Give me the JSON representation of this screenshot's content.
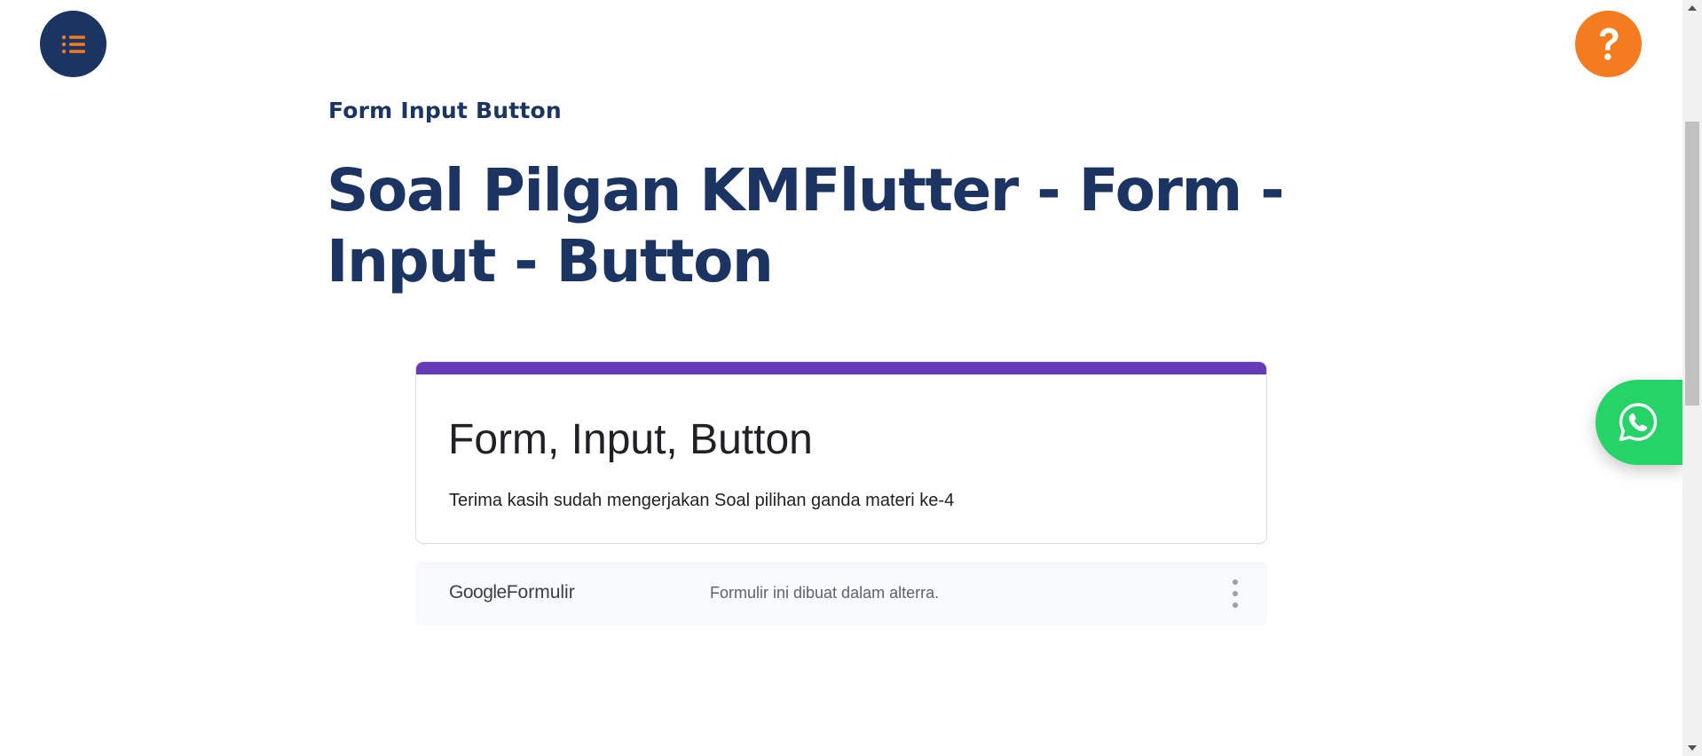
{
  "header": {
    "menu_icon": "list-icon",
    "help_icon": "question-icon",
    "help_symbol": "?"
  },
  "article": {
    "subtitle": "Form Input Button",
    "title": "Soal Pilgan KMFlutter - Form - Input - Button"
  },
  "embedded_form": {
    "title": "Form, Input, Button",
    "description": "Terima kasih sudah mengerjakan Soal pilihan ganda materi ke-4",
    "accent_color": "#673ab7"
  },
  "form_footer": {
    "brand_google": "Google",
    "brand_product": "Formulir",
    "note": "Formulir ini dibuat dalam alterra.",
    "menu_icon": "more-vert-icon"
  },
  "floating": {
    "whatsapp_icon": "whatsapp-icon"
  },
  "colors": {
    "navy": "#1b3461",
    "orange": "#f47b20",
    "whatsapp": "#25d366"
  }
}
